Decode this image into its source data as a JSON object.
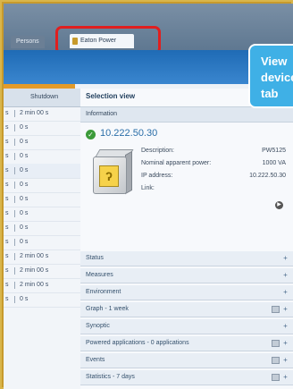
{
  "tabs": {
    "persons": "Persons",
    "eaton": "Eaton Power"
  },
  "left_list": {
    "header": {
      "col_shutdown": "Shutdown"
    },
    "rows": [
      {
        "key": "s",
        "value": "2 min 00 s"
      },
      {
        "key": "s",
        "value": "0 s"
      },
      {
        "key": "s",
        "value": "0 s"
      },
      {
        "key": "s",
        "value": "0 s"
      },
      {
        "key": "s",
        "value": "0 s"
      },
      {
        "key": "s",
        "value": "0 s"
      },
      {
        "key": "s",
        "value": "0 s"
      },
      {
        "key": "s",
        "value": "0 s"
      },
      {
        "key": "s",
        "value": "0 s"
      },
      {
        "key": "s",
        "value": "0 s"
      },
      {
        "key": "s",
        "value": "2 min 00 s"
      },
      {
        "key": "s",
        "value": "2 min 00 s"
      },
      {
        "key": "s",
        "value": "2 min 00 s"
      },
      {
        "key": "s",
        "value": "0 s"
      }
    ]
  },
  "detail": {
    "selection_title": "Selection view",
    "information_label": "Information",
    "ip": "10.222.50.30",
    "fields": [
      {
        "label": "Description:",
        "value": "PW5125"
      },
      {
        "label": "Nominal apparent power:",
        "value": "1000 VA"
      },
      {
        "label": "IP address:",
        "value": "10.222.50.30"
      },
      {
        "label": "Link:",
        "value": ""
      }
    ],
    "sections": [
      {
        "label": "Status",
        "has_icon": false
      },
      {
        "label": "Measures",
        "has_icon": false
      },
      {
        "label": "Environment",
        "has_icon": false
      },
      {
        "label": "Graph - 1 week",
        "has_icon": true
      },
      {
        "label": "Synoptic",
        "has_icon": false
      },
      {
        "label": "Powered applications - 0 applications",
        "has_icon": true
      },
      {
        "label": "Events",
        "has_icon": true
      },
      {
        "label": "Statistics - 7 days",
        "has_icon": true
      }
    ]
  },
  "callout": {
    "line1": "View",
    "line2": "device",
    "line3": "tab"
  },
  "colors": {
    "highlight": "#e01f1f",
    "accent_blue": "#1f6bb5",
    "callout": "#3fb0e6",
    "frame": "#c79a2c"
  }
}
